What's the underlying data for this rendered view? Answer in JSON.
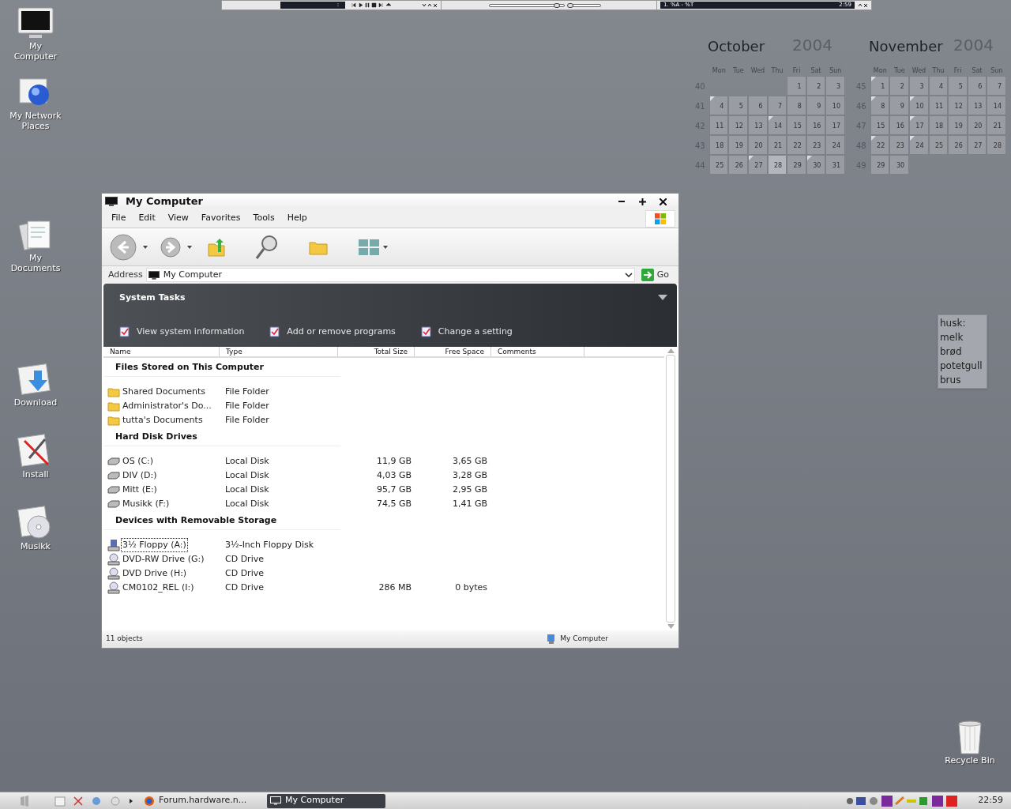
{
  "top_bar": {
    "player_display": ":",
    "track_display": "1. %A - %T",
    "time_display": "2:59",
    "seek": {
      "level": 0.9
    },
    "volume": {
      "level": 0.05
    }
  },
  "desktop_icons": [
    {
      "label": "My Computer",
      "kind": "monitor"
    },
    {
      "label": "My Network Places",
      "kind": "globe"
    },
    {
      "label": "My Documents",
      "kind": "docs"
    },
    {
      "label": "Download",
      "kind": "download"
    },
    {
      "label": "Install",
      "kind": "install"
    },
    {
      "label": "Musikk",
      "kind": "cd"
    },
    {
      "label": "Recycle Bin",
      "kind": "bin"
    }
  ],
  "calendars": [
    {
      "month": "October",
      "year": "2004",
      "weekdays": [
        "Mon",
        "Tue",
        "Wed",
        "Thu",
        "Fri",
        "Sat",
        "Sun"
      ],
      "weeks": [
        {
          "number": "40",
          "days": [
            {
              "n": "1",
              "marked": false,
              "today": false
            },
            {
              "n": "2",
              "marked": false,
              "today": false
            },
            {
              "n": "3",
              "marked": false,
              "today": false
            }
          ]
        },
        {
          "number": "41",
          "days": [
            {
              "n": "4",
              "marked": true,
              "today": false
            },
            {
              "n": "5",
              "marked": false,
              "today": false
            },
            {
              "n": "6",
              "marked": false,
              "today": false
            },
            {
              "n": "7",
              "marked": false,
              "today": false
            },
            {
              "n": "8",
              "marked": false,
              "today": false
            },
            {
              "n": "9",
              "marked": false,
              "today": false
            },
            {
              "n": "10",
              "marked": false,
              "today": false
            }
          ]
        },
        {
          "number": "42",
          "days": [
            {
              "n": "11",
              "marked": false,
              "today": false
            },
            {
              "n": "12",
              "marked": false,
              "today": false
            },
            {
              "n": "13",
              "marked": false,
              "today": false
            },
            {
              "n": "14",
              "marked": true,
              "today": false
            },
            {
              "n": "15",
              "marked": false,
              "today": false
            },
            {
              "n": "16",
              "marked": false,
              "today": false
            },
            {
              "n": "17",
              "marked": false,
              "today": false
            }
          ]
        },
        {
          "number": "43",
          "days": [
            {
              "n": "18",
              "marked": false,
              "today": false
            },
            {
              "n": "19",
              "marked": false,
              "today": false
            },
            {
              "n": "20",
              "marked": false,
              "today": false
            },
            {
              "n": "21",
              "marked": false,
              "today": false
            },
            {
              "n": "22",
              "marked": false,
              "today": false
            },
            {
              "n": "23",
              "marked": false,
              "today": false
            },
            {
              "n": "24",
              "marked": false,
              "today": false
            }
          ]
        },
        {
          "number": "44",
          "days": [
            {
              "n": "25",
              "marked": false,
              "today": false
            },
            {
              "n": "26",
              "marked": false,
              "today": false
            },
            {
              "n": "27",
              "marked": true,
              "today": false
            },
            {
              "n": "28",
              "marked": false,
              "today": true
            },
            {
              "n": "29",
              "marked": false,
              "today": false
            },
            {
              "n": "30",
              "marked": true,
              "today": false
            },
            {
              "n": "31",
              "marked": false,
              "today": false
            }
          ]
        }
      ]
    },
    {
      "month": "November",
      "year": "2004",
      "weekdays": [
        "Mon",
        "Tue",
        "Wed",
        "Thu",
        "Fri",
        "Sat",
        "Sun"
      ],
      "weeks": [
        {
          "number": "45",
          "days": [
            {
              "n": "1",
              "marked": true,
              "today": false
            },
            {
              "n": "2",
              "marked": false,
              "today": false
            },
            {
              "n": "3",
              "marked": false,
              "today": false
            },
            {
              "n": "4",
              "marked": false,
              "today": false
            },
            {
              "n": "5",
              "marked": false,
              "today": false
            },
            {
              "n": "6",
              "marked": false,
              "today": false
            },
            {
              "n": "7",
              "marked": false,
              "today": false
            }
          ]
        },
        {
          "number": "46",
          "days": [
            {
              "n": "8",
              "marked": true,
              "today": false
            },
            {
              "n": "9",
              "marked": false,
              "today": false
            },
            {
              "n": "10",
              "marked": true,
              "today": false
            },
            {
              "n": "11",
              "marked": false,
              "today": false
            },
            {
              "n": "12",
              "marked": false,
              "today": false
            },
            {
              "n": "13",
              "marked": false,
              "today": false
            },
            {
              "n": "14",
              "marked": false,
              "today": false
            }
          ]
        },
        {
          "number": "47",
          "days": [
            {
              "n": "15",
              "marked": false,
              "today": false
            },
            {
              "n": "16",
              "marked": false,
              "today": false
            },
            {
              "n": "17",
              "marked": true,
              "today": false
            },
            {
              "n": "18",
              "marked": false,
              "today": false
            },
            {
              "n": "19",
              "marked": false,
              "today": false
            },
            {
              "n": "20",
              "marked": false,
              "today": false
            },
            {
              "n": "21",
              "marked": false,
              "today": false
            }
          ]
        },
        {
          "number": "48",
          "days": [
            {
              "n": "22",
              "marked": true,
              "today": false
            },
            {
              "n": "23",
              "marked": false,
              "today": false
            },
            {
              "n": "24",
              "marked": true,
              "today": false
            },
            {
              "n": "25",
              "marked": false,
              "today": false
            },
            {
              "n": "26",
              "marked": false,
              "today": false
            },
            {
              "n": "27",
              "marked": false,
              "today": false
            },
            {
              "n": "28",
              "marked": false,
              "today": false
            }
          ]
        },
        {
          "number": "49",
          "days": [
            {
              "n": "29",
              "marked": false,
              "today": false
            },
            {
              "n": "30",
              "marked": false,
              "today": false
            }
          ]
        }
      ]
    }
  ],
  "note": {
    "lines": [
      "husk:",
      "melk",
      "brød",
      "potetgull",
      "brus"
    ]
  },
  "window": {
    "title": "My Computer",
    "menu": [
      "File",
      "Edit",
      "View",
      "Favorites",
      "Tools",
      "Help"
    ],
    "address": {
      "label": "Address",
      "value": "My Computer",
      "go": "Go"
    },
    "system_tasks": {
      "title": "System Tasks",
      "tasks": [
        "View system information",
        "Add or remove programs",
        "Change a setting"
      ]
    },
    "columns": [
      "Name",
      "Type",
      "Total Size",
      "Free Space",
      "Comments"
    ],
    "groups": [
      {
        "title": "Files Stored on This Computer",
        "rows": [
          {
            "kind": "folder",
            "name": "Shared Documents",
            "type": "File Folder",
            "selected": false
          },
          {
            "kind": "folder",
            "name": "Administrator's Do...",
            "type": "File Folder",
            "selected": false
          },
          {
            "kind": "folder",
            "name": "tutta's Documents",
            "type": "File Folder",
            "selected": false
          }
        ]
      },
      {
        "title": "Hard Disk Drives",
        "rows": [
          {
            "kind": "disk",
            "name": "OS (C:)",
            "type": "Local Disk",
            "total": "11,9 GB",
            "free": "3,65 GB",
            "selected": false
          },
          {
            "kind": "disk",
            "name": "DIV (D:)",
            "type": "Local Disk",
            "total": "4,03 GB",
            "free": "3,28 GB",
            "selected": false
          },
          {
            "kind": "disk",
            "name": "Mitt (E:)",
            "type": "Local Disk",
            "total": "95,7 GB",
            "free": "2,95 GB",
            "selected": false
          },
          {
            "kind": "disk",
            "name": "Musikk (F:)",
            "type": "Local Disk",
            "total": "74,5 GB",
            "free": "1,41 GB",
            "selected": false
          }
        ]
      },
      {
        "title": "Devices with Removable Storage",
        "rows": [
          {
            "kind": "floppy",
            "name": "3½ Floppy (A:)",
            "type": "3½-Inch Floppy Disk",
            "selected": true
          },
          {
            "kind": "cd",
            "name": "DVD-RW Drive (G:)",
            "type": "CD Drive",
            "selected": false
          },
          {
            "kind": "cd",
            "name": "DVD Drive (H:)",
            "type": "CD Drive",
            "selected": false
          },
          {
            "kind": "cd",
            "name": "CM0102_REL (I:)",
            "type": "CD Drive",
            "total": "286 MB",
            "free": "0 bytes",
            "selected": false
          }
        ]
      }
    ],
    "status": {
      "count": "11 objects",
      "location": "My Computer"
    }
  },
  "taskbar": {
    "tasks": [
      {
        "label": "Forum.hardware.n...",
        "kind": "browser",
        "selected": false
      },
      {
        "label": "My Computer",
        "kind": "explorer",
        "selected": true
      }
    ],
    "clock": "22:59"
  }
}
